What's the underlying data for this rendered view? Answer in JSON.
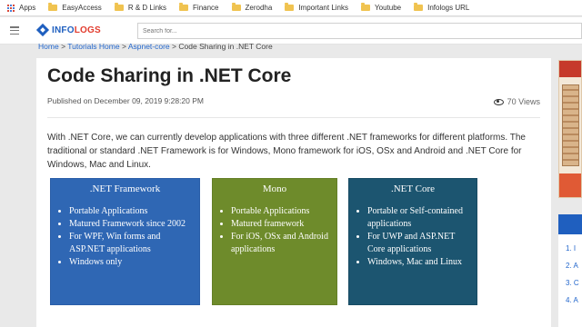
{
  "bookmarks": {
    "items": [
      {
        "label": "Apps"
      },
      {
        "label": "EasyAccess"
      },
      {
        "label": "R & D Links"
      },
      {
        "label": "Finance"
      },
      {
        "label": "Zerodha"
      },
      {
        "label": "Important Links"
      },
      {
        "label": "Youtube"
      },
      {
        "label": "Infologs URL"
      }
    ]
  },
  "header": {
    "logo_text": "INFO",
    "logo_text_accent": "LOGS",
    "search_placeholder": "Search for..."
  },
  "breadcrumb": {
    "home": "Home",
    "tutorials": "Tutorials Home",
    "section": "Aspnet-core",
    "current": "Code Sharing in .NET Core",
    "separator": ">"
  },
  "article": {
    "title": "Code Sharing in .NET Core",
    "published": "Published on December 09, 2019 9:28:20 PM",
    "views": "70 Views",
    "intro": "With .NET Core, we can currently develop applications with three different .NET frameworks for different platforms. The traditional or standard .NET Framework is for Windows, Mono framework for iOS, OSx and Android and .NET Core for Windows, Mac and Linux."
  },
  "frameworks": [
    {
      "title": ".NET Framework",
      "color": "#2f67b4",
      "points": [
        "Portable Applications",
        "Matured Framework since 2002",
        "For WPF, Win forms and ASP.NET applications",
        "Windows only"
      ]
    },
    {
      "title": "Mono",
      "color": "#6e8b2b",
      "points": [
        "Portable Applications",
        "Matured framework",
        "For iOS, OSx and Android applications"
      ]
    },
    {
      "title": ".NET Core",
      "color": "#1c5570",
      "points": [
        "Portable or Self-contained applications",
        "For UWP and ASP.NET Core applications",
        "Windows, Mac and Linux"
      ]
    }
  ],
  "sidebar": {
    "list_markers": [
      "1. I",
      "2. A",
      "3. C",
      "4. A"
    ]
  },
  "colors": {
    "brand_blue": "#1f5fbf",
    "brand_red": "#e23c2e",
    "link": "#2266cc"
  }
}
